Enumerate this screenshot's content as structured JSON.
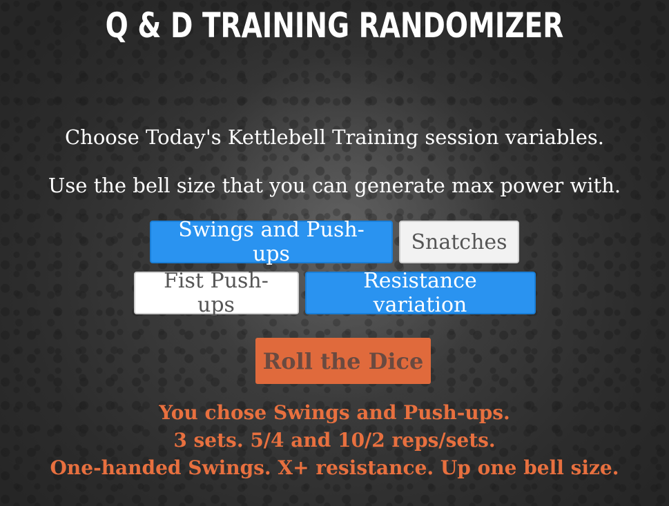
{
  "header": {
    "title": "Q & D TRAINING RANDOMIZER"
  },
  "intro": {
    "line1": "Choose Today's Kettlebell Training session variables.",
    "line2": "Use the bell size that you can generate max power with."
  },
  "options": {
    "row1": [
      {
        "label": "Swings and Push-ups",
        "state": "selected"
      },
      {
        "label": "Snatches",
        "state": "unselected"
      }
    ],
    "row2": [
      {
        "label": "Fist Push-ups",
        "state": "unselected"
      },
      {
        "label": "Resistance variation",
        "state": "selected"
      }
    ]
  },
  "roll_button": {
    "label": "Roll the Dice"
  },
  "result": {
    "line1": "You chose Swings and Push-ups.",
    "line2": "3 sets. 5/4 and 10/2 reps/sets.",
    "line3": "One-handed Swings. X+ resistance. Up one bell size."
  },
  "colors": {
    "selected": "#2a93f0",
    "unselected": "#f2f2f2",
    "accent": "#e06a3c",
    "result_text": "#e8703f"
  }
}
